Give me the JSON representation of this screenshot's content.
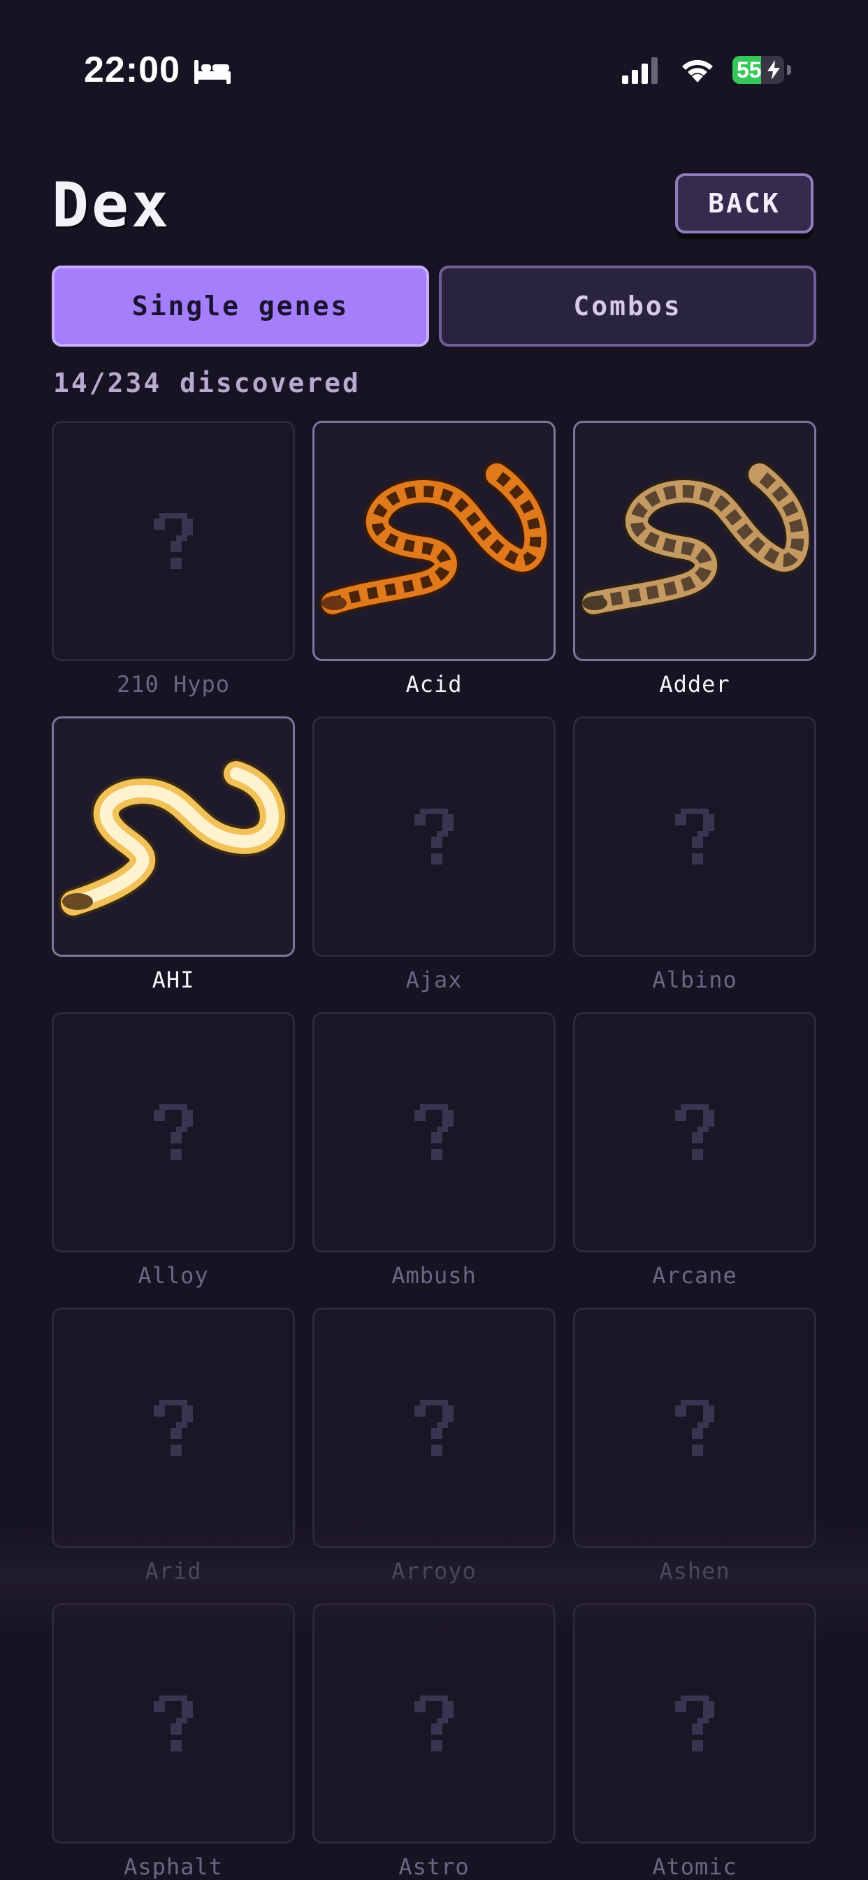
{
  "status_bar": {
    "time": "22:00",
    "battery": "55",
    "battery_level": 0.55,
    "icons": [
      "bed-icon",
      "signal-icon",
      "wifi-icon",
      "battery-icon",
      "charging-bolt-icon"
    ]
  },
  "header": {
    "title": "Dex",
    "back_label": "BACK"
  },
  "tabs": [
    {
      "label": "Single genes",
      "active": true
    },
    {
      "label": "Combos",
      "active": false
    }
  ],
  "progress": {
    "text": "14/234 discovered"
  },
  "colors": {
    "background": "#181322",
    "accent": "#a47efb",
    "card_border_found": "#7d74a0",
    "card_border_locked": "#2d283a"
  },
  "genes": [
    {
      "name": "210 Hypo",
      "discovered": false
    },
    {
      "name": "Acid",
      "discovered": true
    },
    {
      "name": "Adder",
      "discovered": true
    },
    {
      "name": "AHI",
      "discovered": true
    },
    {
      "name": "Ajax",
      "discovered": false
    },
    {
      "name": "Albino",
      "discovered": false
    },
    {
      "name": "Alloy",
      "discovered": false
    },
    {
      "name": "Ambush",
      "discovered": false
    },
    {
      "name": "Arcane",
      "discovered": false
    },
    {
      "name": "Arid",
      "discovered": false
    },
    {
      "name": "Arroyo",
      "discovered": false
    },
    {
      "name": "Ashen",
      "discovered": false
    },
    {
      "name": "Asphalt",
      "discovered": false
    },
    {
      "name": "Astro",
      "discovered": false
    },
    {
      "name": "Atomic",
      "discovered": false
    }
  ]
}
